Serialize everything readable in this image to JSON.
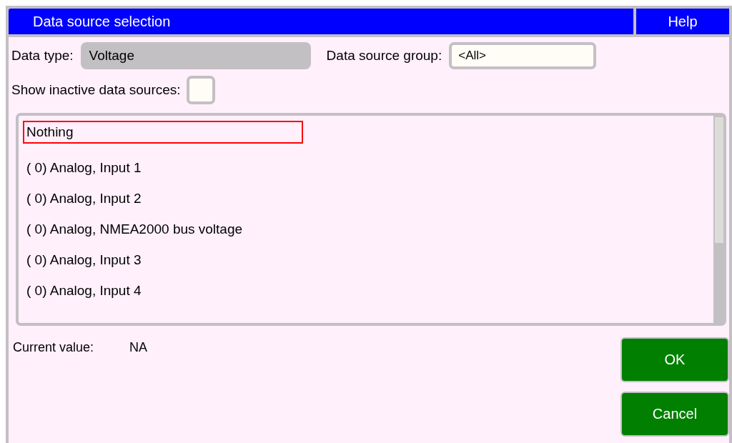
{
  "window": {
    "title": "Data source selection",
    "help": "Help"
  },
  "data_type": {
    "label": "Data type:",
    "value": "Voltage"
  },
  "data_source_group": {
    "label": "Data source group:",
    "value": "<All>"
  },
  "show_inactive": {
    "label": "Show inactive data sources:",
    "checked": false
  },
  "sources": [
    {
      "label": "Nothing",
      "selected": true
    },
    {
      "label": "( 0) Analog, Input 1",
      "selected": false
    },
    {
      "label": "( 0) Analog, Input 2",
      "selected": false
    },
    {
      "label": "( 0) Analog, NMEA2000 bus voltage",
      "selected": false
    },
    {
      "label": "( 0) Analog, Input 3",
      "selected": false
    },
    {
      "label": "( 0) Analog, Input 4",
      "selected": false
    }
  ],
  "current_value": {
    "label": "Current value:",
    "value": "NA"
  },
  "buttons": [
    {
      "label": "OK"
    },
    {
      "label": "Cancel"
    }
  ]
}
